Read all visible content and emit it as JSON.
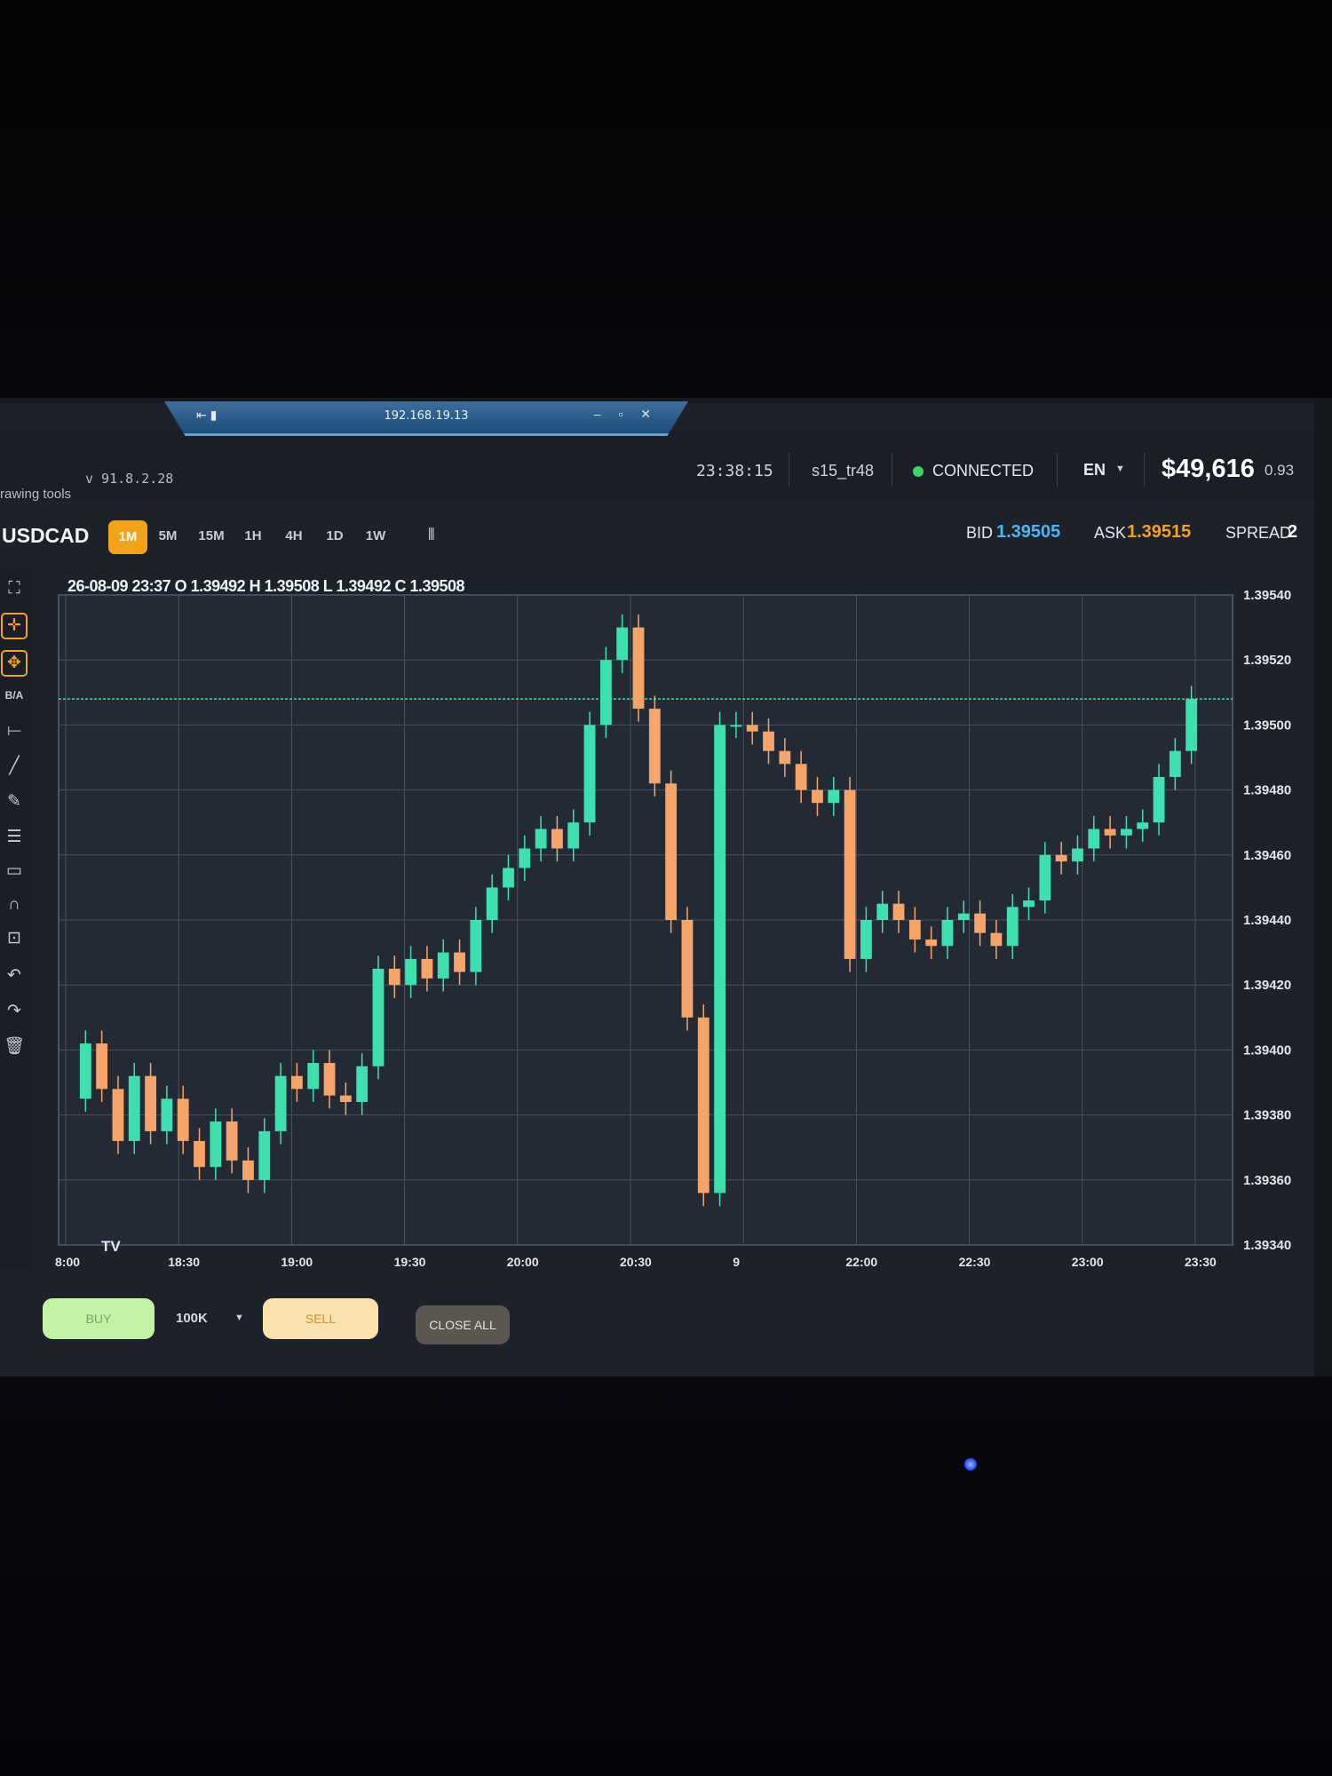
{
  "remote_bar": {
    "ip": "192.168.19.13",
    "left_icons": "⇤ ▮",
    "window_controls": "– ▫ ✕"
  },
  "header": {
    "version": "v 91.8.2.28",
    "drawing_tools_label": "rawing tools",
    "time": "23:38:15",
    "account": "s15_tr48",
    "status": "CONNECTED",
    "status_color": "#3ed46c",
    "language": "EN",
    "balance": "$49,616",
    "percent": "0.93"
  },
  "toolbar": {
    "symbol": "USDCAD",
    "timeframes": [
      "1M",
      "5M",
      "15M",
      "1H",
      "4H",
      "1D",
      "1W"
    ],
    "active_timeframe": "1M",
    "chart_type_icon": "candlestick-icon",
    "bid_label": "BID",
    "bid": "1.39505",
    "ask_label": "ASK",
    "ask": "1.39515",
    "spread_label": "SPREAD",
    "spread": "2"
  },
  "sidebar_tools": [
    "fullscreen-icon",
    "crosshair-icon",
    "move-icon",
    "B/A",
    "horizontal-line-icon",
    "trend-line-icon",
    "ruler-icon",
    "fib-levels-icon",
    "rectangle-icon",
    "magnet-icon",
    "lock-icon",
    "undo-icon",
    "redo-icon",
    "trash-icon"
  ],
  "chart_data": {
    "type": "candlestick",
    "ohlc_header": "26-08-09 23:37 O 1.39492 H 1.39508 L 1.39492 C 1.39508",
    "y_ticks": [
      "1.39540",
      "1.39520",
      "1.39500",
      "1.39480",
      "1.39460",
      "1.39440",
      "1.39420",
      "1.39400",
      "1.39380",
      "1.39360",
      "1.39340"
    ],
    "ylim": [
      1.3934,
      1.3954
    ],
    "x_ticks": [
      "8:00",
      "18:30",
      "19:00",
      "19:30",
      "20:00",
      "20:30",
      "9",
      "22:00",
      "22:30",
      "23:00",
      "23:30"
    ],
    "price_line": 1.39508,
    "up_color": "#3fe0b0",
    "down_color": "#f5a46a",
    "series": [
      {
        "t": "18:00",
        "close": 1.39385
      },
      {
        "t": "18:05",
        "close": 1.39402
      },
      {
        "t": "18:10",
        "close": 1.39388
      },
      {
        "t": "18:15",
        "close": 1.39372
      },
      {
        "t": "18:20",
        "close": 1.39392
      },
      {
        "t": "18:25",
        "close": 1.39375
      },
      {
        "t": "18:30",
        "close": 1.39385
      },
      {
        "t": "18:35",
        "close": 1.39372
      },
      {
        "t": "18:40",
        "close": 1.39364
      },
      {
        "t": "18:45",
        "close": 1.39378
      },
      {
        "t": "18:50",
        "close": 1.39366
      },
      {
        "t": "18:55",
        "close": 1.3936
      },
      {
        "t": "19:00",
        "close": 1.39375
      },
      {
        "t": "19:05",
        "close": 1.39392
      },
      {
        "t": "19:10",
        "close": 1.39388
      },
      {
        "t": "19:15",
        "close": 1.39396
      },
      {
        "t": "19:20",
        "close": 1.39386
      },
      {
        "t": "19:25",
        "close": 1.39384
      },
      {
        "t": "19:30",
        "close": 1.39395
      },
      {
        "t": "19:35",
        "close": 1.39425
      },
      {
        "t": "19:40",
        "close": 1.3942
      },
      {
        "t": "19:45",
        "close": 1.39428
      },
      {
        "t": "19:50",
        "close": 1.39422
      },
      {
        "t": "19:55",
        "close": 1.3943
      },
      {
        "t": "20:00",
        "close": 1.39424
      },
      {
        "t": "20:05",
        "close": 1.3944
      },
      {
        "t": "20:10",
        "close": 1.3945
      },
      {
        "t": "20:15",
        "close": 1.39456
      },
      {
        "t": "20:20",
        "close": 1.39462
      },
      {
        "t": "20:25",
        "close": 1.39468
      },
      {
        "t": "20:30",
        "close": 1.39462
      },
      {
        "t": "20:35",
        "close": 1.3947
      },
      {
        "t": "20:40",
        "close": 1.395
      },
      {
        "t": "20:45",
        "close": 1.3952
      },
      {
        "t": "20:50",
        "close": 1.3953
      },
      {
        "t": "20:55",
        "close": 1.39505
      },
      {
        "t": "21:00",
        "close": 1.39482
      },
      {
        "t": "21:05",
        "close": 1.3944
      },
      {
        "t": "21:10",
        "close": 1.3941
      },
      {
        "t": "21:15",
        "close": 1.39356
      },
      {
        "t": "21:20",
        "close": 1.395
      },
      {
        "t": "21:25",
        "close": 1.395
      },
      {
        "t": "21:30",
        "close": 1.39498
      },
      {
        "t": "21:35",
        "close": 1.39492
      },
      {
        "t": "21:40",
        "close": 1.39488
      },
      {
        "t": "21:45",
        "close": 1.3948
      },
      {
        "t": "21:50",
        "close": 1.39476
      },
      {
        "t": "21:55",
        "close": 1.3948
      },
      {
        "t": "22:00",
        "close": 1.39428
      },
      {
        "t": "22:05",
        "close": 1.3944
      },
      {
        "t": "22:10",
        "close": 1.39445
      },
      {
        "t": "22:15",
        "close": 1.3944
      },
      {
        "t": "22:20",
        "close": 1.39434
      },
      {
        "t": "22:25",
        "close": 1.39432
      },
      {
        "t": "22:30",
        "close": 1.3944
      },
      {
        "t": "22:35",
        "close": 1.39442
      },
      {
        "t": "22:40",
        "close": 1.39436
      },
      {
        "t": "22:45",
        "close": 1.39432
      },
      {
        "t": "22:50",
        "close": 1.39444
      },
      {
        "t": "22:55",
        "close": 1.39446
      },
      {
        "t": "23:00",
        "close": 1.3946
      },
      {
        "t": "23:05",
        "close": 1.39458
      },
      {
        "t": "23:10",
        "close": 1.39462
      },
      {
        "t": "23:15",
        "close": 1.39468
      },
      {
        "t": "23:20",
        "close": 1.39466
      },
      {
        "t": "23:25",
        "close": 1.39468
      },
      {
        "t": "23:30",
        "close": 1.3947
      },
      {
        "t": "23:33",
        "close": 1.39484
      },
      {
        "t": "23:35",
        "close": 1.39492
      },
      {
        "t": "23:37",
        "close": 1.39508
      }
    ]
  },
  "chart_footer": {
    "logo": "TV"
  },
  "order_bar": {
    "buy_label": "BUY",
    "quantity": "100K",
    "sell_label": "SELL",
    "close_all_label": "CLOSE ALL"
  }
}
